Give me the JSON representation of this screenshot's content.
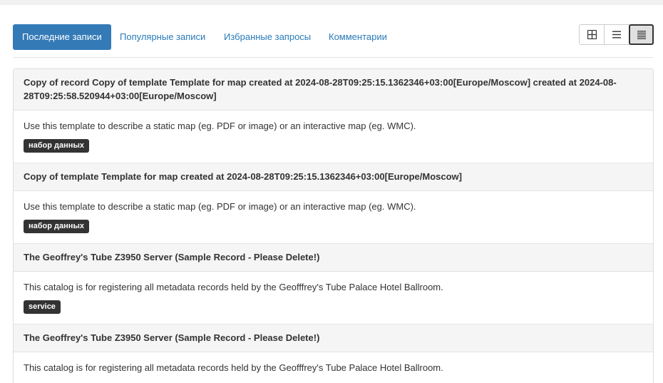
{
  "tabs": [
    {
      "label": "Последние записи",
      "active": true
    },
    {
      "label": "Популярные записи",
      "active": false
    },
    {
      "label": "Избранные запросы",
      "active": false
    },
    {
      "label": "Комментарии",
      "active": false
    }
  ],
  "view_buttons": [
    {
      "icon": "grid-view-icon",
      "active": false
    },
    {
      "icon": "list-view-icon",
      "active": false
    },
    {
      "icon": "compact-list-view-icon",
      "active": true
    }
  ],
  "records": [
    {
      "title": "Copy of record Copy of template Template for map created at 2024-08-28T09:25:15.1362346+03:00[Europe/Moscow] created at 2024-08-28T09:25:58.520944+03:00[Europe/Moscow]",
      "description": "Use this template to describe a static map (eg. PDF or image) or an interactive map (eg. WMC).",
      "badge": "набор данных"
    },
    {
      "title": "Copy of template Template for map created at 2024-08-28T09:25:15.1362346+03:00[Europe/Moscow]",
      "description": "Use this template to describe a static map (eg. PDF or image) or an interactive map (eg. WMC).",
      "badge": "набор данных"
    },
    {
      "title": "The Geoffrey's Tube Z3950 Server (Sample Record - Please Delete!)",
      "description": "This catalog is for registering all metadata records held by the Geofffrey's Tube Palace Hotel Ballroom.",
      "badge": "service"
    },
    {
      "title": "The Geoffrey's Tube Z3950 Server (Sample Record - Please Delete!)",
      "description": "This catalog is for registering all metadata records held by the Geofffrey's Tube Palace Hotel Ballroom.",
      "badge": ""
    }
  ]
}
